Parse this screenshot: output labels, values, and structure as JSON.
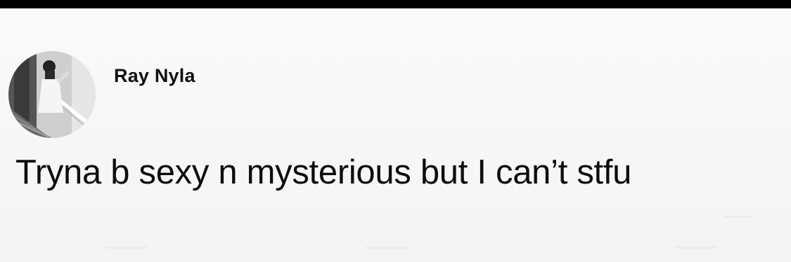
{
  "post": {
    "author": {
      "name": "Ray Nyla",
      "avatar_icon": "profile-photo-avatar"
    },
    "text": "Tryna b sexy n mysterious but I can’t stfu"
  },
  "colors": {
    "background": "#f7f7f7",
    "text": "#0d0d0d",
    "top_bar": "#000000"
  }
}
